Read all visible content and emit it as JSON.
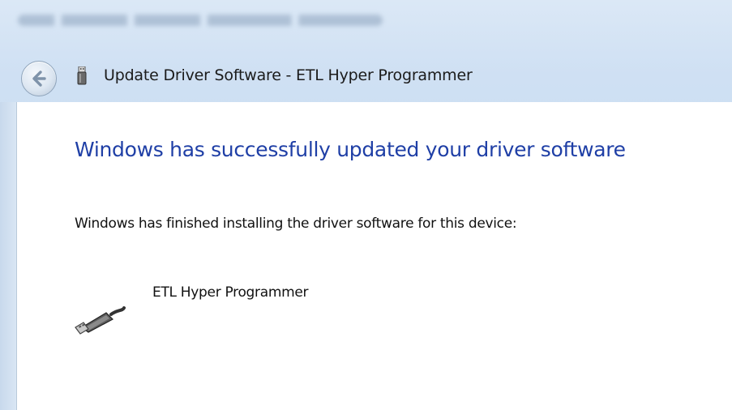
{
  "window": {
    "title": "Update Driver Software - ETL Hyper Programmer"
  },
  "content": {
    "heading": "Windows has successfully updated your driver software",
    "message": "Windows has finished installing the driver software for this device:",
    "device_name": "ETL Hyper Programmer"
  },
  "colors": {
    "heading": "#1f3fa6",
    "frame": "#c4d9ef"
  },
  "icons": {
    "back": "back-arrow-icon",
    "window": "usb-device-icon",
    "device": "usb-cable-icon"
  }
}
